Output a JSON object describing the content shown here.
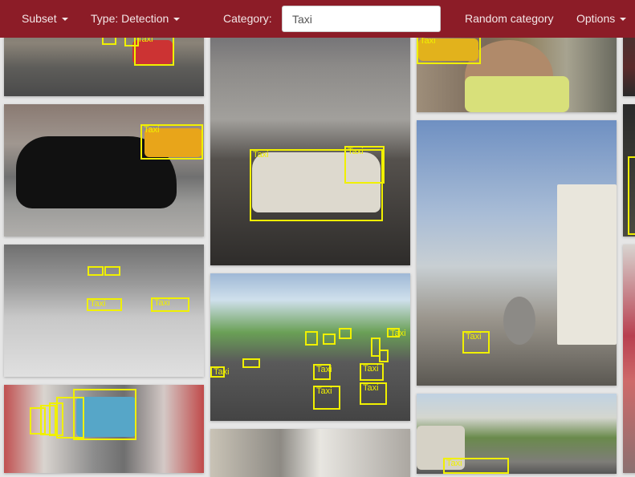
{
  "navbar": {
    "subset_label": "Subset",
    "type_label": "Type: Detection",
    "category_label": "Category:",
    "category_value": "Taxi",
    "random_label": "Random category",
    "options_label": "Options"
  },
  "box_label": "Taxi",
  "colors": {
    "navbar": "#8c1c27",
    "box": "#f0f000"
  }
}
